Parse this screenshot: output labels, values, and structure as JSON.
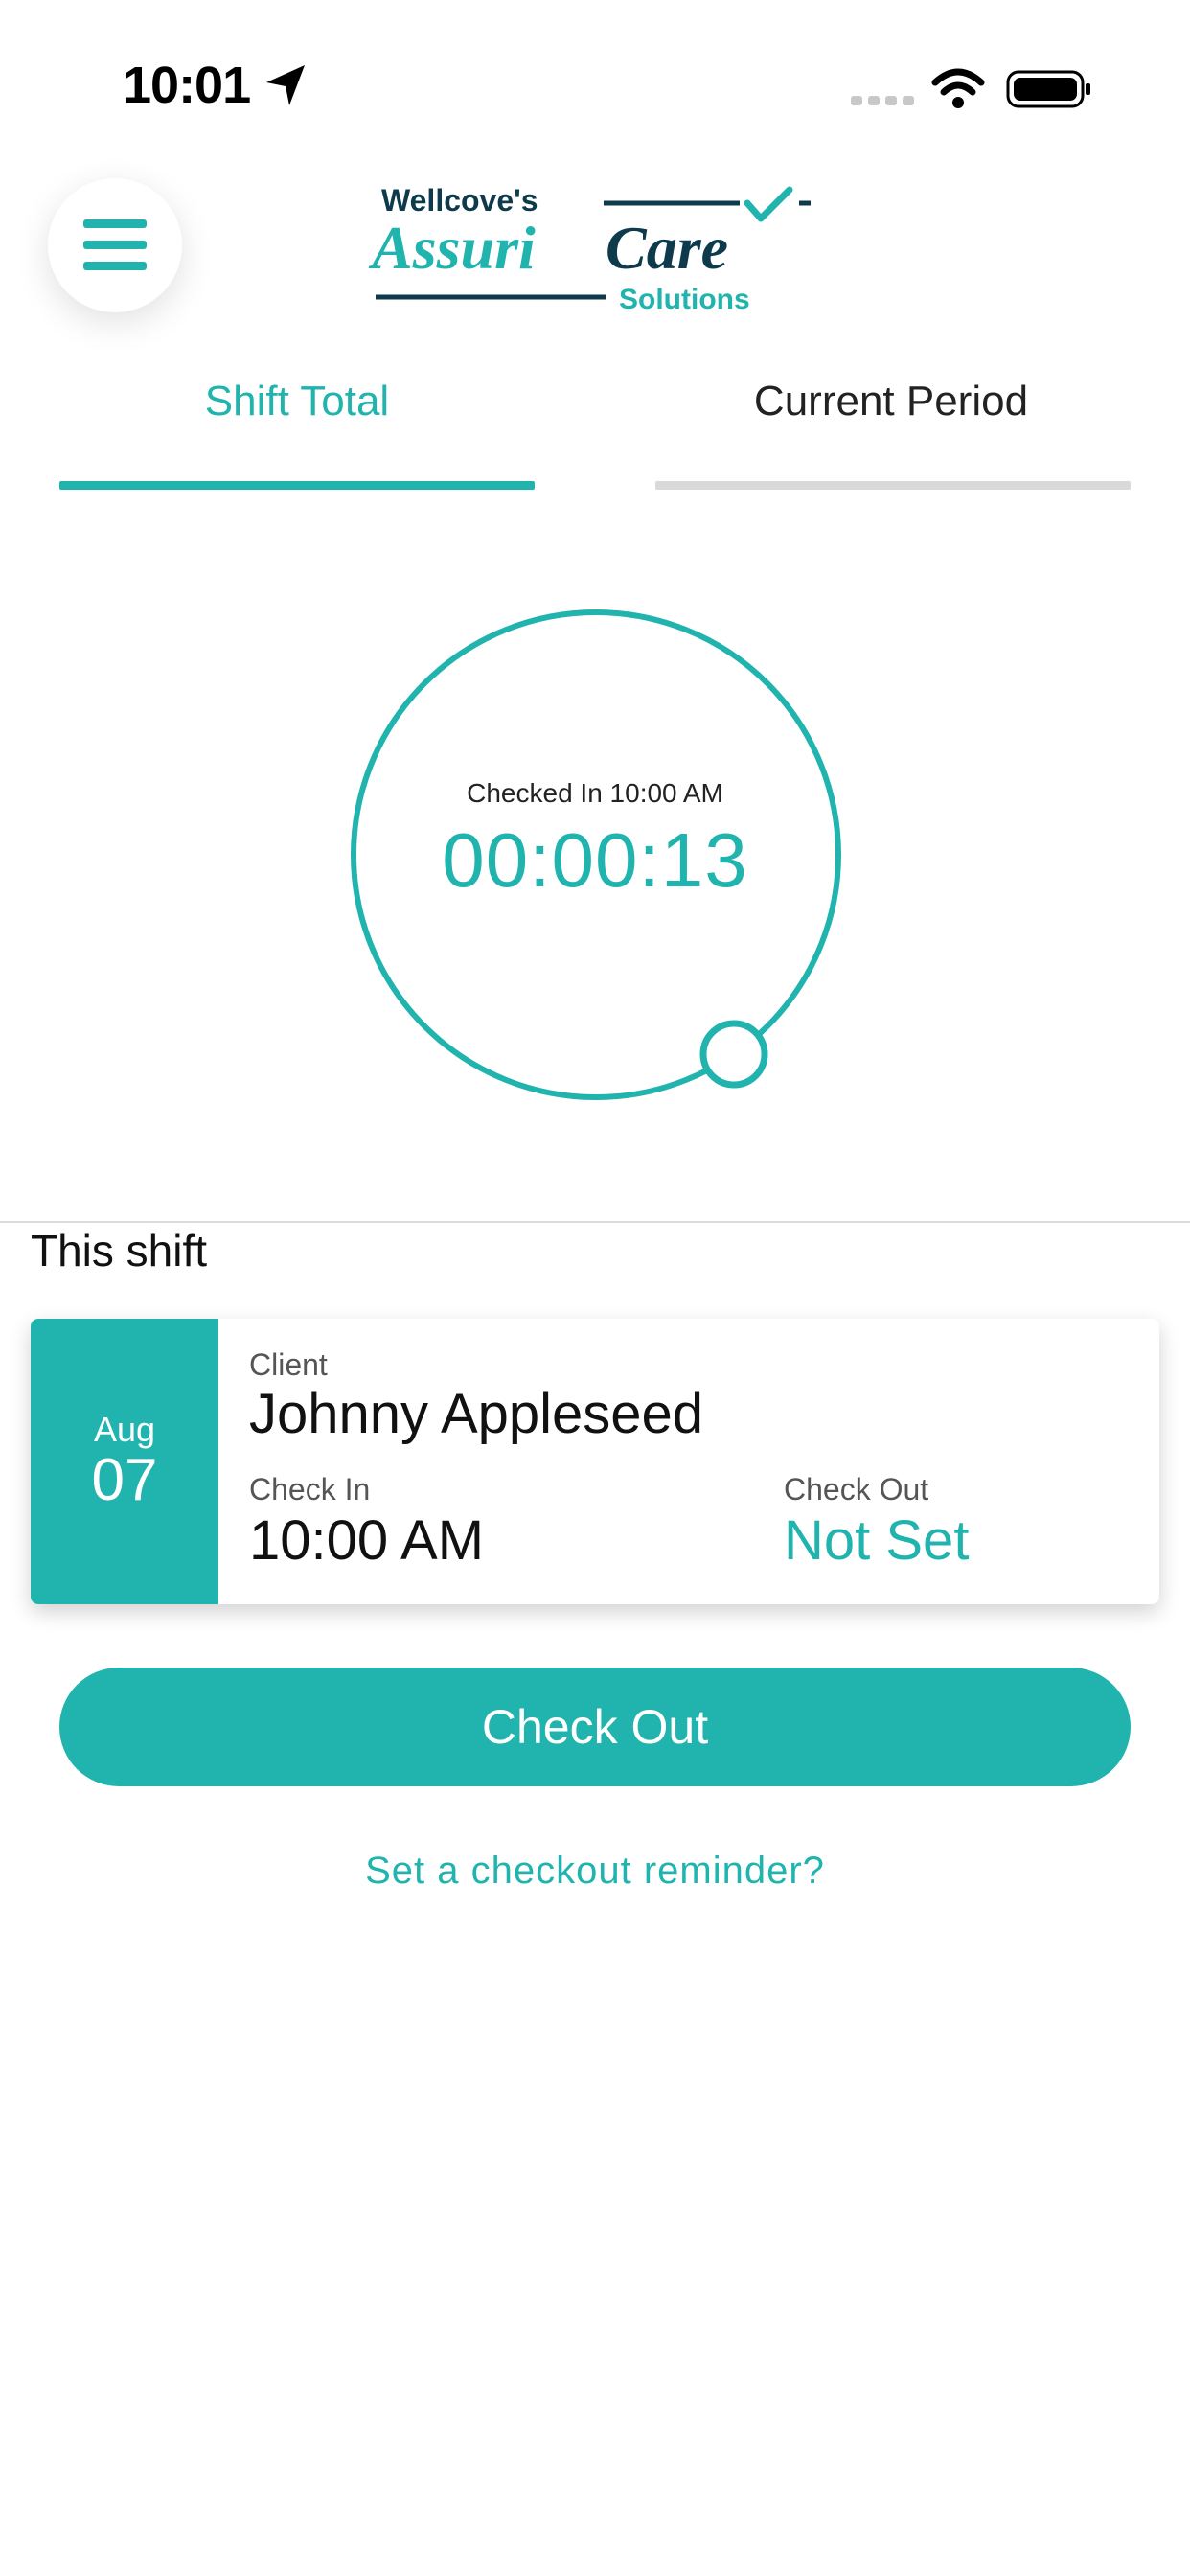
{
  "status_bar": {
    "time": "10:01",
    "location_icon": "location-arrow-icon",
    "signal_icon": "cell-signal-icon",
    "wifi_icon": "wifi-icon",
    "battery_icon": "battery-icon"
  },
  "header": {
    "menu_icon": "hamburger-menu-icon",
    "logo": {
      "line1": "Wellcove's",
      "line2_part1": "Assuri",
      "line2_part2": "Care",
      "line3": "Solutions"
    }
  },
  "tabs": [
    {
      "label": "Shift Total",
      "active": true
    },
    {
      "label": "Current Period",
      "active": false
    }
  ],
  "timer": {
    "checked_in_label": "Checked In 10:00 AM",
    "elapsed": "00:00:13",
    "progress_fraction": 0.04
  },
  "shift_section": {
    "title": "This shift",
    "card": {
      "month": "Aug",
      "day": "07",
      "client_label": "Client",
      "client_name": "Johnny Appleseed",
      "check_in_label": "Check In",
      "check_in_value": "10:00 AM",
      "check_out_label": "Check Out",
      "check_out_value": "Not Set"
    }
  },
  "actions": {
    "checkout_button": "Check Out",
    "reminder_link": "Set a checkout reminder?"
  },
  "colors": {
    "accent": "#21b4ae",
    "logo_dark": "#0d3b4c",
    "inactive_tab": "#d9d9d9"
  }
}
